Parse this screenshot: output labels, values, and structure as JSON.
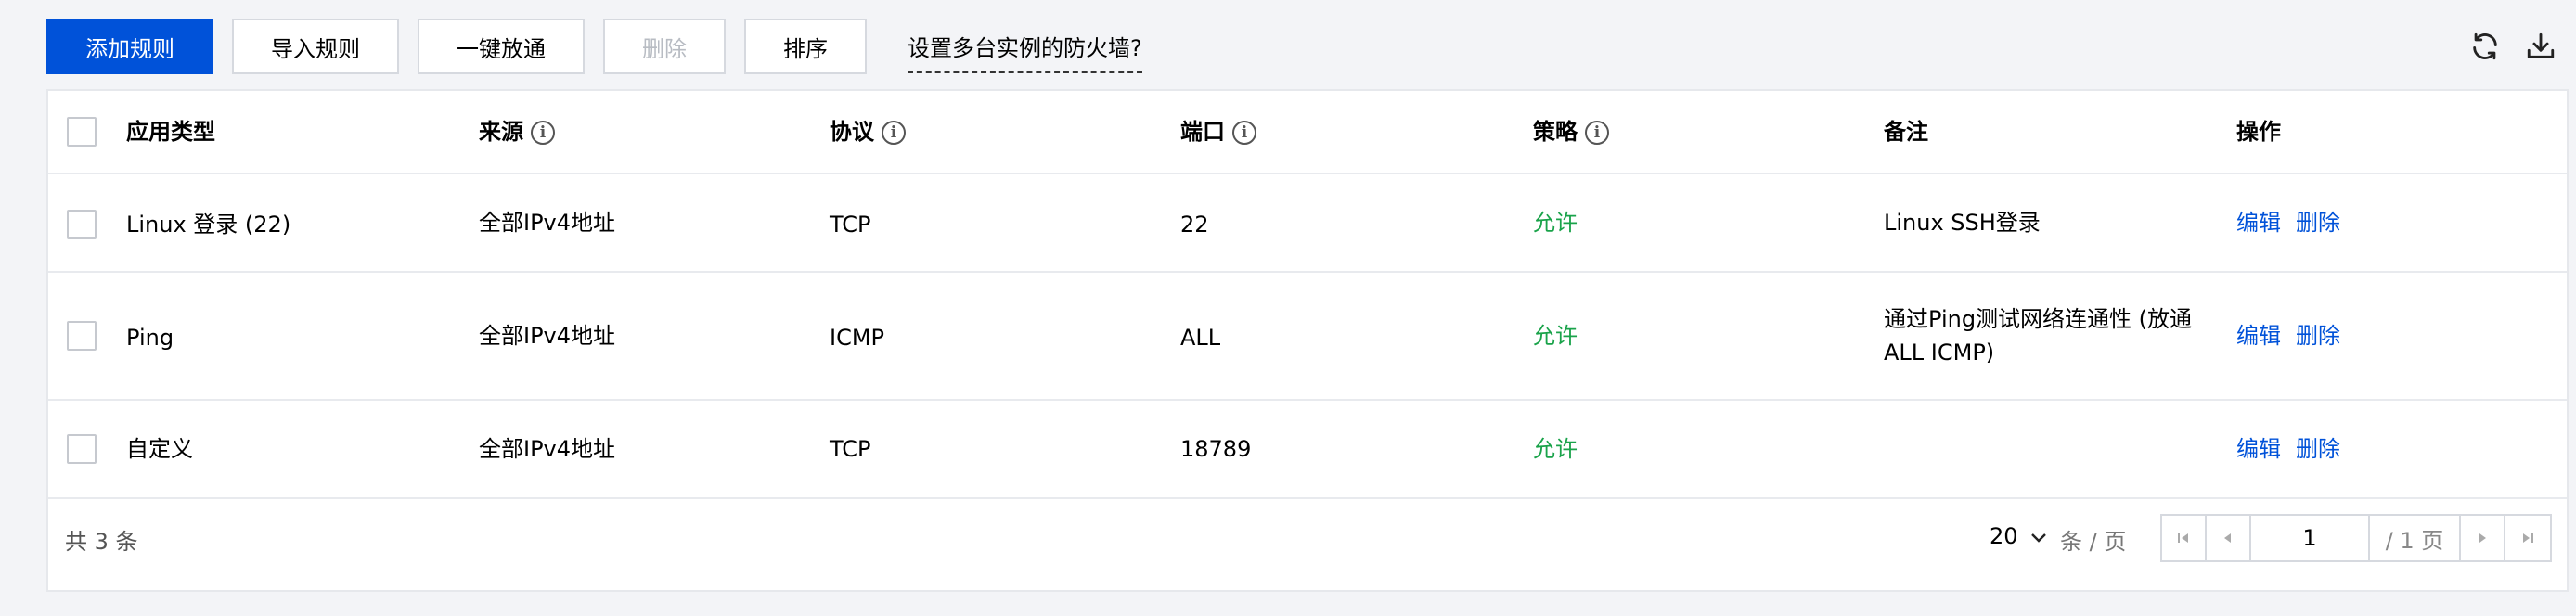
{
  "toolbar": {
    "add_rule": "添加规则",
    "import_rule": "导入规则",
    "one_click_allow": "一键放通",
    "delete": "删除",
    "sort": "排序",
    "multi_instance_help": "设置多台实例的防火墙?",
    "refresh_icon": "refresh-icon",
    "download_icon": "download-icon"
  },
  "table": {
    "columns": [
      "应用类型",
      "来源",
      "协议",
      "端口",
      "策略",
      "备注",
      "操作"
    ],
    "rows": [
      {
        "app_type": "Linux 登录 (22)",
        "source": "全部IPv4地址",
        "protocol": "TCP",
        "port": "22",
        "policy": "允许",
        "note_line1": "Linux SSH登录",
        "note_line2": "",
        "edit": "编辑",
        "delete": "删除"
      },
      {
        "app_type": "Ping",
        "source": "全部IPv4地址",
        "protocol": "ICMP",
        "port": "ALL",
        "policy": "允许",
        "note_line1": "通过Ping测试网络连通性 (放通",
        "note_line2": "ALL ICMP)",
        "edit": "编辑",
        "delete": "删除"
      },
      {
        "app_type": "自定义",
        "source": "全部IPv4地址",
        "protocol": "TCP",
        "port": "18789",
        "policy": "允许",
        "note_line1": "",
        "note_line2": "",
        "edit": "编辑",
        "delete": "删除"
      }
    ]
  },
  "footer": {
    "total": "共 3 条",
    "page_size": "20",
    "page_size_unit": "条 / 页",
    "current_page": "1",
    "total_pages": "/ 1 页"
  },
  "colors": {
    "primary": "#0052d9",
    "allow": "#1aa34a"
  }
}
